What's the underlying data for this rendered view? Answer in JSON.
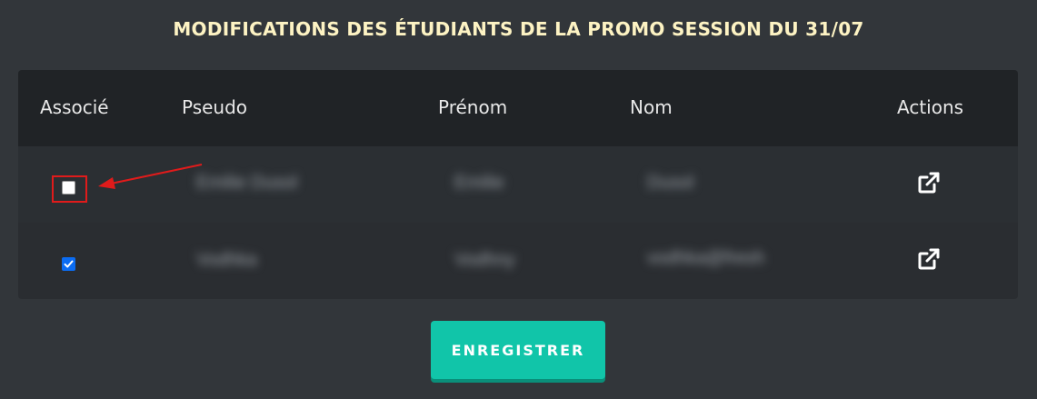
{
  "page": {
    "title": "MODIFICATIONS DES ÉTUDIANTS DE LA PROMO SESSION DU 31/07"
  },
  "table": {
    "headers": {
      "associe": "Associé",
      "pseudo": "Pseudo",
      "prenom": "Prénom",
      "nom": "Nom",
      "actions": "Actions"
    },
    "rows": [
      {
        "associe_checked": false,
        "pseudo": "Emilie Dusol",
        "prenom": "Emilie",
        "nom": "Dusol",
        "action_icon": "external-link-icon"
      },
      {
        "associe_checked": true,
        "pseudo": "Vodhka",
        "prenom": "Vodhny",
        "nom": "vodhka@fresh",
        "action_icon": "external-link-icon"
      }
    ]
  },
  "actions": {
    "save_label": "ENREGISTRER"
  },
  "colors": {
    "background": "#32363a",
    "header_bg": "#202326",
    "title": "#fdf3c3",
    "accent": "#11c5a9",
    "annotation": "#e01b1b",
    "checkbox_checked": "#0b6cf2"
  }
}
